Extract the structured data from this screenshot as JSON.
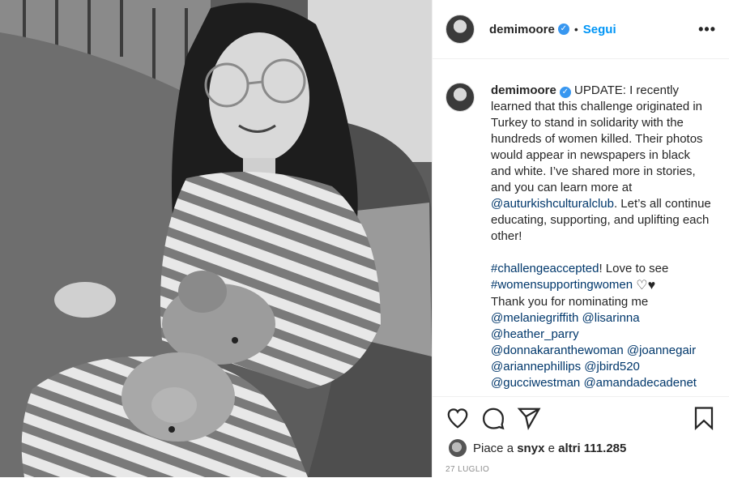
{
  "post": {
    "username": "demimoore",
    "verified_icon": "verified-badge-icon",
    "dot": "•",
    "follow_label": "Segui",
    "more_icon": "•••"
  },
  "caption": {
    "username": "demimoore",
    "text_part1": "UPDATE: I recently learned that this challenge originated in Turkey to stand in solidarity with the hundreds of women killed. Their photos would appear in newspapers in black and white. I’ve shared more in stories, and you can learn more at ",
    "mention_culture": "@auturkishculturalclub",
    "text_part2": ". Let’s all continue educating, supporting, and uplifting each other!",
    "hashtag1": "#challengeaccepted",
    "text_part3": "! Love to see",
    "hashtag2": "#womensupportingwomen",
    "hearts": [
      "♡",
      "♥"
    ],
    "text_part4": "Thank you for nominating me",
    "mentions": [
      "@melaniegriffith",
      "@lisarinna",
      "@heather_parry",
      "@donnakaranthewoman",
      "@joannegair",
      "@ariannephillips",
      "@jbird520",
      "@gucciwestman",
      "@amandadecadenet"
    ]
  },
  "likes": {
    "prefix": "Piace a",
    "first_user": "snyx",
    "conj": "e",
    "others": "altri 111.285"
  },
  "date": "27 LUGLIO",
  "icons": [
    "heart-icon",
    "comment-icon",
    "share-icon",
    "bookmark-icon"
  ],
  "colors": {
    "link": "#00376b",
    "follow": "#0095f6",
    "verified": "#3897f0"
  }
}
